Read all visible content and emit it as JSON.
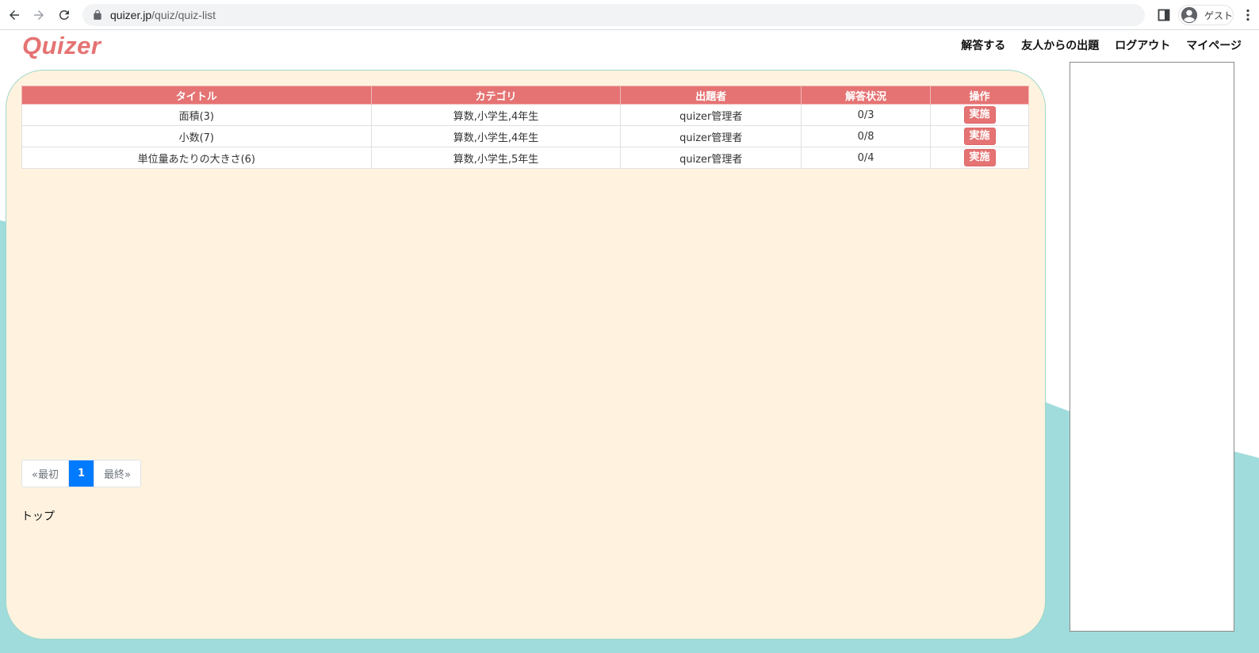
{
  "browser": {
    "url_host": "quizer.jp",
    "url_path": "/quiz/quiz-list",
    "profile_label": "ゲスト"
  },
  "site": {
    "logo": "Quizer",
    "nav": [
      "解答する",
      "友人からの出題",
      "ログアウト",
      "マイページ"
    ]
  },
  "table": {
    "headers": [
      "タイトル",
      "カテゴリ",
      "出題者",
      "解答状況",
      "操作"
    ],
    "rows": [
      {
        "title": "面積(3)",
        "category": "算数,小学生,4年生",
        "author": "quizer管理者",
        "status": "0/3",
        "action": "実施"
      },
      {
        "title": "小数(7)",
        "category": "算数,小学生,4年生",
        "author": "quizer管理者",
        "status": "0/8",
        "action": "実施"
      },
      {
        "title": "単位量あたりの大きさ(6)",
        "category": "算数,小学生,5年生",
        "author": "quizer管理者",
        "status": "0/4",
        "action": "実施"
      }
    ]
  },
  "pagination": {
    "first": "«最初",
    "current": "1",
    "last": "最終»"
  },
  "footer": {
    "top_link": "トップ"
  },
  "colors": {
    "accent": "#e57373",
    "panel_bg": "#fff3e0",
    "wave": "#a0dcdc",
    "active_page": "#007bff"
  }
}
